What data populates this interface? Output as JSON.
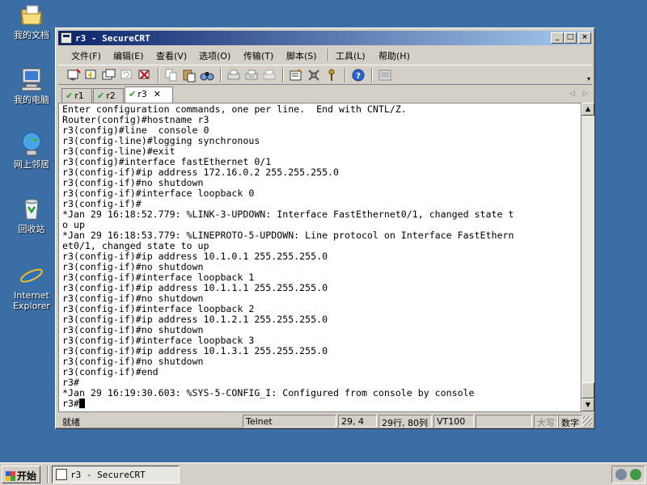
{
  "desktop": {
    "icons": [
      {
        "label": "我的文档",
        "icon": "folder-documents-icon"
      },
      {
        "label": "我的电脑",
        "icon": "computer-icon"
      },
      {
        "label": "网上邻居",
        "icon": "network-icon"
      },
      {
        "label": "回收站",
        "icon": "recycle-bin-icon"
      },
      {
        "label": "Internet Explorer",
        "icon": "internet-explorer-icon"
      }
    ]
  },
  "window": {
    "title": "r3 - SecureCRT",
    "controls": {
      "minimize": "_",
      "maximize": "□",
      "close": "×"
    },
    "menu": [
      "文件(F)",
      "编辑(E)",
      "查看(V)",
      "选项(O)",
      "传输(T)",
      "脚本(S)",
      "工具(L)",
      "帮助(H)"
    ],
    "toolbar_icons": [
      "connect-icon",
      "quick-connect-icon",
      "connect-tab-icon",
      "reconnect-icon",
      "disconnect-icon",
      "copy-icon",
      "paste-icon",
      "find-icon",
      "print-setup-icon",
      "print-selection-icon",
      "print-icon",
      "session-options-icon",
      "global-options-icon",
      "keymap-icon",
      "help-icon",
      "about-icon"
    ],
    "tabs": [
      {
        "label": "r1",
        "status": "✔",
        "active": false
      },
      {
        "label": "r2",
        "status": "✔",
        "active": false
      },
      {
        "label": "r3",
        "status": "✔",
        "active": true,
        "close": "✕"
      }
    ],
    "tab_nav": {
      "left": "◁",
      "right": "▷"
    },
    "terminal": {
      "lines": [
        "Enter configuration commands, one per line.  End with CNTL/Z.",
        "Router(config)#hostname r3",
        "r3(config)#line  console 0",
        "r3(config-line)#logging synchronous",
        "r3(config-line)#exit",
        "r3(config)#interface fastEthernet 0/1",
        "r3(config-if)#ip address 172.16.0.2 255.255.255.0",
        "r3(config-if)#no shutdown",
        "r3(config-if)#interface loopback 0",
        "r3(config-if)#",
        "*Jan 29 16:18:52.779: %LINK-3-UPDOWN: Interface FastEthernet0/1, changed state t",
        "o up",
        "*Jan 29 16:18:53.779: %LINEPROTO-5-UPDOWN: Line protocol on Interface FastEthern",
        "et0/1, changed state to up",
        "r3(config-if)#ip address 10.1.0.1 255.255.255.0",
        "r3(config-if)#no shutdown",
        "r3(config-if)#interface loopback 1",
        "r3(config-if)#ip address 10.1.1.1 255.255.255.0",
        "r3(config-if)#no shutdown",
        "r3(config-if)#interface loopback 2",
        "r3(config-if)#ip address 10.1.2.1 255.255.255.0",
        "r3(config-if)#no shutdown",
        "r3(config-if)#interface loopback 3",
        "r3(config-if)#ip address 10.1.3.1 255.255.255.0",
        "r3(config-if)#no shutdown",
        "r3(config-if)#end",
        "r3#",
        "*Jan 29 16:19:30.603: %SYS-5-CONFIG_I: Configured from console by console"
      ],
      "prompt": "r3#"
    },
    "scrollbar": {
      "up": "▲",
      "down": "▼"
    },
    "status": {
      "ready": "就绪",
      "protocol": "Telnet",
      "cursor_pos": "29,  4",
      "size": "29行, 80列",
      "emulation": "VT100",
      "caps": "大写",
      "num": "数字"
    }
  },
  "taskbar": {
    "start_label": "开始",
    "task_label": "r3 - SecureCRT"
  }
}
